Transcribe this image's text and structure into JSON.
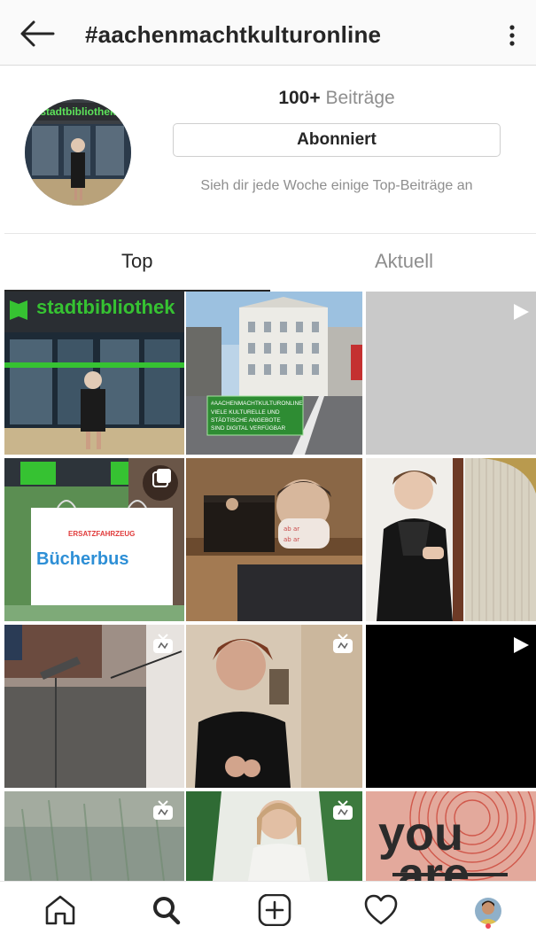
{
  "header": {
    "title": "#aachenmachtkulturonline",
    "back_icon": "arrow-left-icon",
    "menu_icon": "more-vertical-icon"
  },
  "profile": {
    "post_count": "100+",
    "post_label": "Beiträge",
    "follow_button": "Abonniert",
    "note": "Sieh dir jede Woche einige Top-Beiträge an",
    "avatar_sign": "stadtbibliothek"
  },
  "tabs": [
    {
      "label": "Top",
      "active": true
    },
    {
      "label": "Aktuell",
      "active": false
    }
  ],
  "grid": {
    "posts": [
      {
        "id": "post-1",
        "badge": null,
        "sign_text": "stadtbibliothek"
      },
      {
        "id": "post-2",
        "badge": null,
        "overlay_lines": [
          "#AACHENMACHTKULTURONLINE",
          "VIELE KULTURELLE UND",
          "STÄDTISCHE ANGEBOTE",
          "SIND DIGITAL VERFÜGBAR"
        ]
      },
      {
        "id": "post-3",
        "badge": "play-icon"
      },
      {
        "id": "post-4",
        "badge": "carousel-icon",
        "sign_small": "ERSATZFAHRZEUG",
        "sign_big": "Bücherbus"
      },
      {
        "id": "post-5",
        "badge": null
      },
      {
        "id": "post-6",
        "badge": null
      },
      {
        "id": "post-7",
        "badge": "igtv-icon"
      },
      {
        "id": "post-8",
        "badge": "igtv-icon"
      },
      {
        "id": "post-9",
        "badge": "play-icon"
      },
      {
        "id": "post-10",
        "badge": "igtv-icon"
      },
      {
        "id": "post-11",
        "badge": "igtv-icon"
      },
      {
        "id": "post-12",
        "badge": null,
        "text_top": "you",
        "text_bottom": "are"
      }
    ]
  },
  "bottom_nav": [
    {
      "icon": "home-icon"
    },
    {
      "icon": "search-icon",
      "active": true
    },
    {
      "icon": "new-post-icon"
    },
    {
      "icon": "activity-heart-icon"
    },
    {
      "icon": "profile-avatar",
      "notification": true
    }
  ],
  "colors": {
    "text": "#262626",
    "muted": "#8e8e8e",
    "border": "#dbdbdb",
    "notification": "#ed4956",
    "library_green": "#36c232"
  }
}
